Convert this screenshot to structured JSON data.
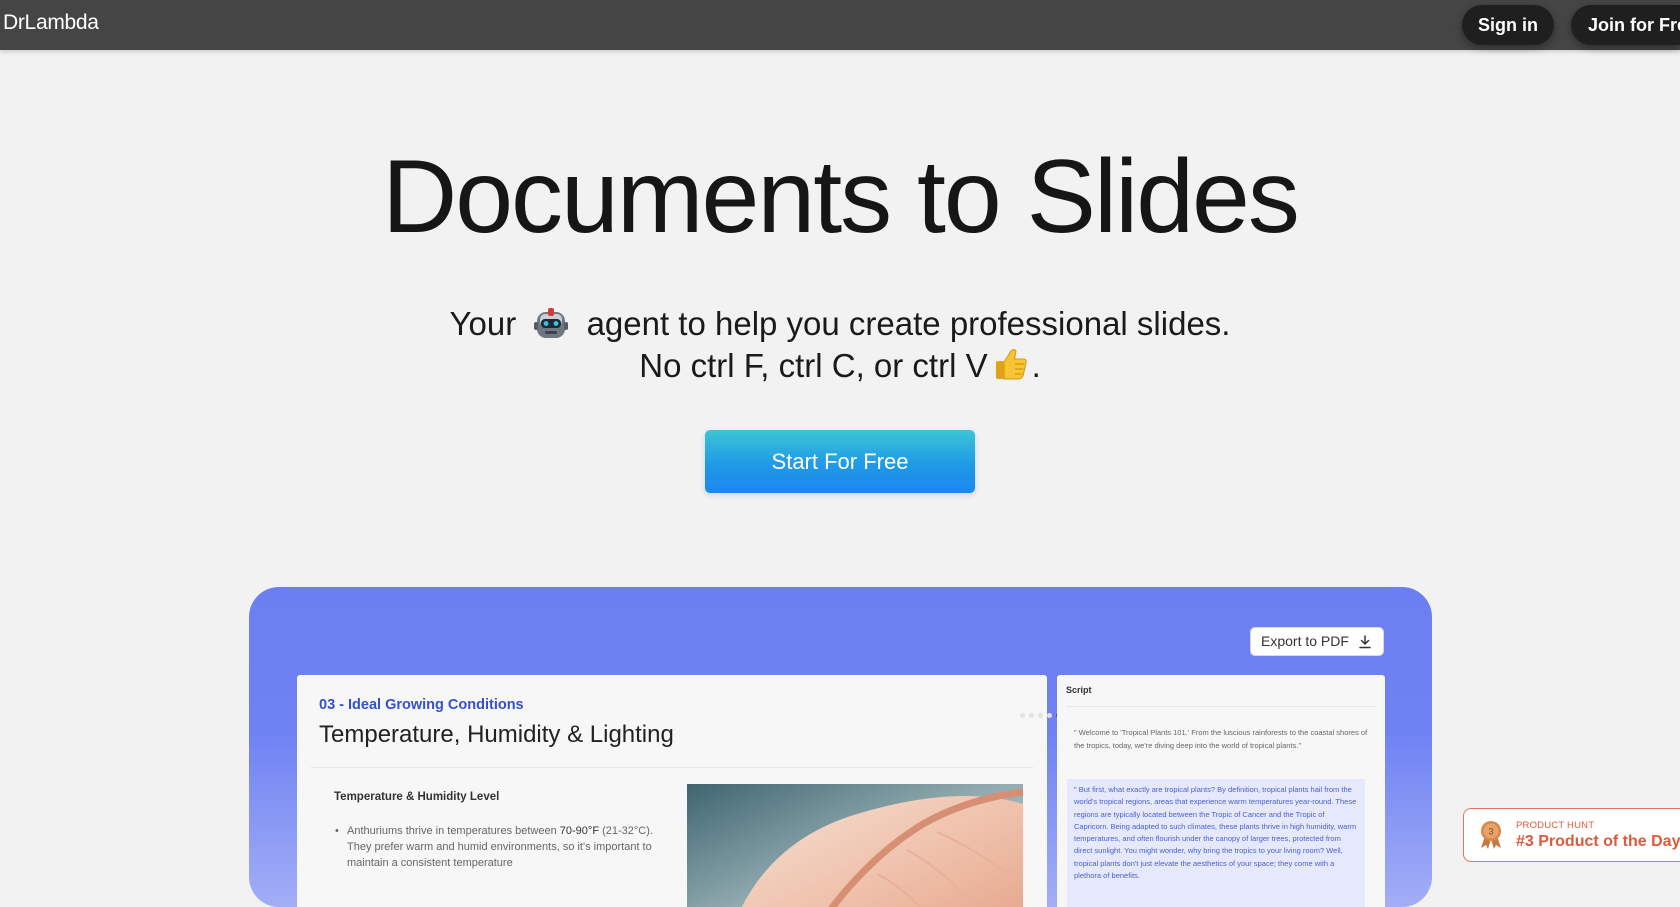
{
  "header": {
    "brand": "DrLambda",
    "sign_in_label": "Sign in",
    "join_label": "Join for Free"
  },
  "hero": {
    "title": "Documents to Slides",
    "subtitle_line1_before": "Your",
    "subtitle_line1_after": "agent to help you create professional slides.",
    "subtitle_line2_before": "No ctrl F, ctrl C, or ctrl V",
    "subtitle_line2_after": ".",
    "cta_label": "Start For Free"
  },
  "demo": {
    "export_label": "Export to PDF",
    "slide": {
      "eyebrow": "03 - Ideal Growing Conditions",
      "title": "Temperature, Humidity & Lighting",
      "section": "Temperature & Humidity Level",
      "bullet_before": "Anthuriums thrive in temperatures between",
      "bullet_bold": "70-90°F",
      "bullet_after": "(21-32°C). They prefer warm and humid environments, so it's important to maintain a consistent temperature"
    },
    "script": {
      "label": "Script",
      "paragraph1": "\" Welcome to 'Tropical Plants 101.' From the luscious rainforests to the coastal shores of the tropics, today, we're diving deep into the world of tropical plants.\"",
      "paragraph2": "\" But first, what exactly are tropical plants? By definition, tropical plants hail from the world's tropical regions, areas that experience warm temperatures year-round. These regions are typically located between the Tropic of Cancer and the Tropic of Capricorn. Being adapted to such climates, these plants thrive in high humidity, warm temperatures, and often flourish under the canopy of larger trees, protected from direct sunlight. You might wonder, why bring the tropics to your living room? Well, tropical plants don't just elevate the aesthetics of your space; they come with a plethora of benefits."
    }
  },
  "badge": {
    "medal_number": "3",
    "label": "PRODUCT HUNT",
    "rank": "#3 Product of the Day"
  },
  "colors": {
    "topbar": "#454545",
    "cta_top": "#3cc6d6",
    "cta_bottom": "#1d86f0",
    "showcase": "#6b7ff2",
    "slide_accent": "#3352c9",
    "badge_accent": "#dd5a3c"
  }
}
